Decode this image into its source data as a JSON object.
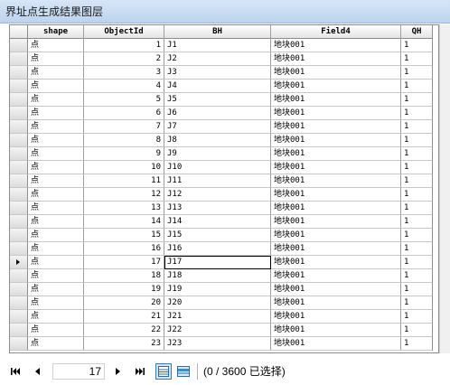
{
  "window": {
    "title": "界址点生成结果图层"
  },
  "table": {
    "columns": [
      "shape",
      "ObjectId",
      "BH",
      "Field4",
      "QH"
    ],
    "active_row_index": 16,
    "rows": [
      [
        "点",
        "1",
        "J1",
        "地块001",
        "1"
      ],
      [
        "点",
        "2",
        "J2",
        "地块001",
        "1"
      ],
      [
        "点",
        "3",
        "J3",
        "地块001",
        "1"
      ],
      [
        "点",
        "4",
        "J4",
        "地块001",
        "1"
      ],
      [
        "点",
        "5",
        "J5",
        "地块001",
        "1"
      ],
      [
        "点",
        "6",
        "J6",
        "地块001",
        "1"
      ],
      [
        "点",
        "7",
        "J7",
        "地块001",
        "1"
      ],
      [
        "点",
        "8",
        "J8",
        "地块001",
        "1"
      ],
      [
        "点",
        "9",
        "J9",
        "地块001",
        "1"
      ],
      [
        "点",
        "10",
        "J10",
        "地块001",
        "1"
      ],
      [
        "点",
        "11",
        "J11",
        "地块001",
        "1"
      ],
      [
        "点",
        "12",
        "J12",
        "地块001",
        "1"
      ],
      [
        "点",
        "13",
        "J13",
        "地块001",
        "1"
      ],
      [
        "点",
        "14",
        "J14",
        "地块001",
        "1"
      ],
      [
        "点",
        "15",
        "J15",
        "地块001",
        "1"
      ],
      [
        "点",
        "16",
        "J16",
        "地块001",
        "1"
      ],
      [
        "点",
        "17",
        "J17",
        "地块001",
        "1"
      ],
      [
        "点",
        "18",
        "J18",
        "地块001",
        "1"
      ],
      [
        "点",
        "19",
        "J19",
        "地块001",
        "1"
      ],
      [
        "点",
        "20",
        "J20",
        "地块001",
        "1"
      ],
      [
        "点",
        "21",
        "J21",
        "地块001",
        "1"
      ],
      [
        "点",
        "22",
        "J22",
        "地块001",
        "1"
      ],
      [
        "点",
        "23",
        "J23",
        "地块001",
        "1"
      ]
    ]
  },
  "navigator": {
    "current_record": "17",
    "status": "(0 / 3600 已选择)",
    "first_icon": "first-record-icon",
    "prev_icon": "previous-record-icon",
    "next_icon": "next-record-icon",
    "last_icon": "last-record-icon"
  }
}
